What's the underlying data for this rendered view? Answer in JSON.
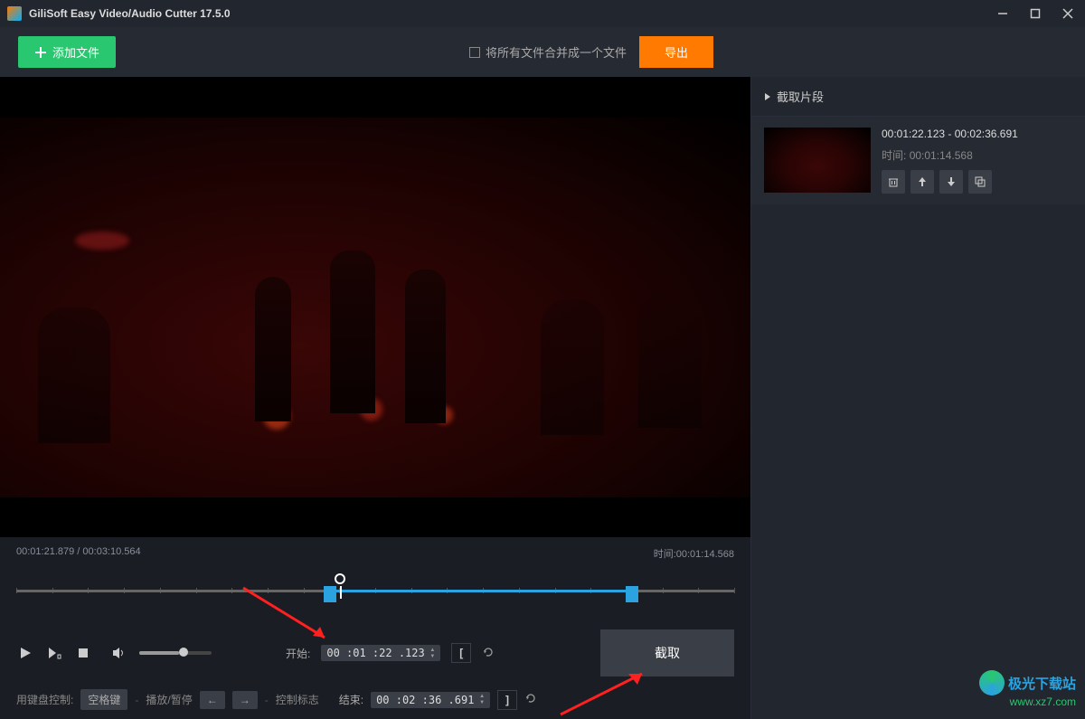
{
  "window": {
    "title": "GiliSoft Easy Video/Audio Cutter 17.5.0"
  },
  "toolbar": {
    "add_file": "添加文件",
    "merge_all": "将所有文件合并成一个文件",
    "export": "导出"
  },
  "player": {
    "current_time": "00:01:21.879",
    "total_time": "00:03:10.564",
    "duration_label": "时间:",
    "duration_value": "00:01:14.568"
  },
  "controls": {
    "start_label": "开始:",
    "end_label": "结束:",
    "start_value": "00 :01 :22 .123",
    "end_value": "00 :02 :36 .691",
    "cut_btn": "截取"
  },
  "keyboard": {
    "label": "用键盘控制:",
    "space_key": "空格键",
    "play_pause": "播放/暂停",
    "ctrl_marks": "控制标志"
  },
  "sidebar": {
    "header": "截取片段",
    "clip": {
      "range": "00:01:22.123 - 00:02:36.691",
      "dur_label": "时间:",
      "dur_value": "00:01:14.568"
    }
  },
  "watermark": {
    "text": "极光下载站",
    "url": "www.xz7.com"
  }
}
